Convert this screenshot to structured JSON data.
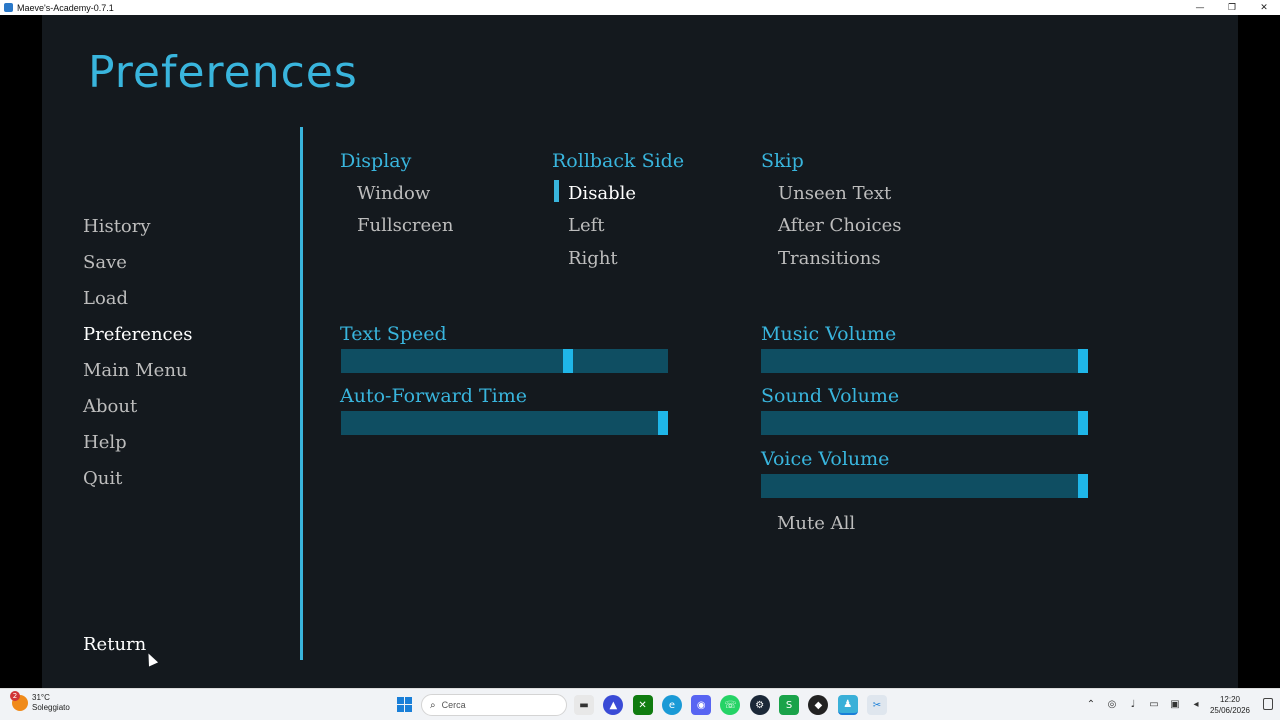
{
  "window": {
    "title": "Maeve's-Academy-0.7.1",
    "minimize": "—",
    "maximize": "❐",
    "close": "✕"
  },
  "page": {
    "title": "Preferences"
  },
  "nav": {
    "items": [
      {
        "label": "History"
      },
      {
        "label": "Save"
      },
      {
        "label": "Load"
      },
      {
        "label": "Preferences",
        "active": true
      },
      {
        "label": "Main Menu"
      },
      {
        "label": "About"
      },
      {
        "label": "Help"
      },
      {
        "label": "Quit"
      }
    ],
    "return_label": "Return"
  },
  "display": {
    "label": "Display",
    "options": [
      "Window",
      "Fullscreen"
    ]
  },
  "rollback": {
    "label": "Rollback Side",
    "options": [
      "Disable",
      "Left",
      "Right"
    ],
    "selected": "Disable"
  },
  "skip": {
    "label": "Skip",
    "options": [
      "Unseen Text",
      "After Choices",
      "Transitions"
    ]
  },
  "sliders": {
    "text_speed": {
      "label": "Text Speed",
      "value": 0.7
    },
    "auto_forward": {
      "label": "Auto-Forward Time",
      "value": 1.0
    },
    "music_volume": {
      "label": "Music Volume",
      "value": 1.0
    },
    "sound_volume": {
      "label": "Sound Volume",
      "value": 1.0
    },
    "voice_volume": {
      "label": "Voice Volume",
      "value": 1.0
    }
  },
  "mute_all": "Mute All",
  "colors": {
    "accent": "#39b5dd",
    "background": "#14191e",
    "slider_track": "#0f4e62",
    "slider_thumb": "#1fb6e8",
    "text_idle": "#bdbdbd",
    "text_active": "#ffffff"
  },
  "taskbar": {
    "weather_temp": "31°C",
    "weather_desc": "Soleggiato",
    "weather_badge": "2",
    "search_placeholder": "Cerca",
    "time": "12:20",
    "date": "25/06/2026",
    "apps": [
      "file-explorer-icon",
      "proton-vpn-icon",
      "xbox-icon",
      "edge-icon",
      "discord-icon",
      "whatsapp-icon",
      "steam-icon",
      "spotify-like-icon",
      "unity-icon",
      "game-icon",
      "snipping-tool-icon"
    ]
  }
}
